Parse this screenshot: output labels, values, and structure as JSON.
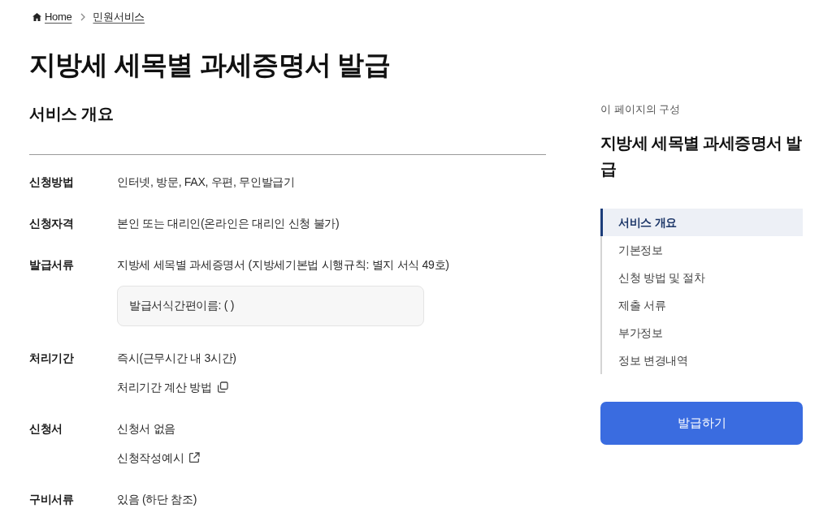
{
  "breadcrumb": [
    {
      "label": "Home",
      "kind": "home"
    },
    {
      "label": "민원서비스",
      "kind": "link"
    }
  ],
  "title": "지방세 세목별 과세증명서 발급",
  "overview": {
    "heading": "서비스 개요",
    "rows": [
      {
        "label": "신청방법",
        "lines": [
          {
            "kind": "text",
            "text": "인터넷, 방문, FAX, 우편, 무인발급기"
          }
        ]
      },
      {
        "label": "신청자격",
        "lines": [
          {
            "kind": "text",
            "text": "본인 또는 대리인(온라인은 대리인 신청 불가)"
          }
        ]
      },
      {
        "label": "발급서류",
        "lines": [
          {
            "kind": "text",
            "text": "지방세 세목별 과세증명서 (지방세기본법 시행규칙: 별지 서식 49호)"
          },
          {
            "kind": "note",
            "text": "발급서식간편이름: ( )"
          }
        ]
      },
      {
        "label": "처리기간",
        "lines": [
          {
            "kind": "text",
            "text": "즉시(근무시간 내 3시간)"
          },
          {
            "kind": "popup",
            "text": "처리기간 계산 방법"
          }
        ]
      },
      {
        "label": "신청서",
        "lines": [
          {
            "kind": "text",
            "text": "신청서 없음"
          },
          {
            "kind": "external",
            "text": "신청작성예시"
          }
        ]
      },
      {
        "label": "구비서류",
        "lines": [
          {
            "kind": "text",
            "text": "있음 (하단 참조)"
          }
        ]
      }
    ]
  },
  "sidebar": {
    "caption": "이 페이지의 구성",
    "title": "지방세 세목별 과세증명서 발급",
    "items": [
      {
        "label": "서비스 개요",
        "selected": true
      },
      {
        "label": "기본정보",
        "selected": false
      },
      {
        "label": "신청 방법 및 절차",
        "selected": false
      },
      {
        "label": "제출 서류",
        "selected": false
      },
      {
        "label": "부가정보",
        "selected": false
      },
      {
        "label": "정보 변경내역",
        "selected": false
      }
    ],
    "action_button": "발급하기"
  }
}
